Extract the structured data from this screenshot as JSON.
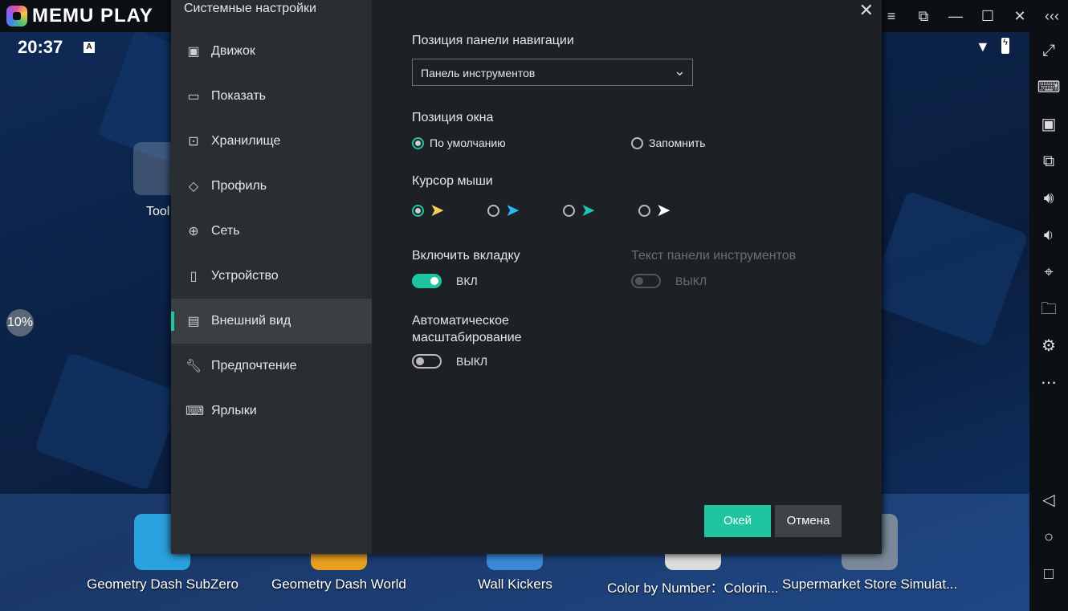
{
  "titlebar": {
    "logo": "MEMU PLAY",
    "controls": [
      "≡",
      "⧉",
      "—",
      "☐",
      "✕",
      "‹‹‹"
    ]
  },
  "status": {
    "time": "20:37",
    "badge": "A"
  },
  "home": {
    "folder_label": "Tool",
    "progress": "10%"
  },
  "dock": [
    "Geometry Dash SubZero",
    "Geometry Dash World",
    "Wall Kickers",
    "Color by Number：Colorin...",
    "Supermarket Store Simulat..."
  ],
  "right_toolbar": [
    "fullscreen-icon",
    "keyboard-icon",
    "apk-icon",
    "multi-window-icon",
    "volume-up-icon",
    "volume-down-icon",
    "location-icon",
    "folder-icon",
    "settings-icon",
    "more-icon",
    "back-icon",
    "home-icon",
    "recents-icon"
  ],
  "dialog": {
    "title": "Системные настройки",
    "nav": [
      "Движок",
      "Показать",
      "Хранилище",
      "Профиль",
      "Сеть",
      "Устройство",
      "Внешний вид",
      "Предпочтение",
      "Ярлыки"
    ],
    "active_nav": "Внешний вид",
    "nav_position_label": "Позиция панели навигации",
    "nav_position_value": "Панель инструментов",
    "window_position_label": "Позиция окна",
    "window_options": [
      "По умолчанию",
      "Запомнить"
    ],
    "cursor_label": "Курсор мыши",
    "cursor_colors": [
      "#f0cf5a",
      "#2ab8f0",
      "#1fc4b0",
      "#ffffff"
    ],
    "tab_label": "Включить вкладку",
    "tab_state": "ВКЛ",
    "toolbar_text_label": "Текст панели инструментов",
    "toolbar_text_state": "ВЫКЛ",
    "autoscale_label": "Автоматическое масштабирование",
    "autoscale_state": "ВЫКЛ",
    "ok": "Окей",
    "cancel": "Отмена"
  },
  "colors": {
    "accent": "#1fc4a0"
  }
}
